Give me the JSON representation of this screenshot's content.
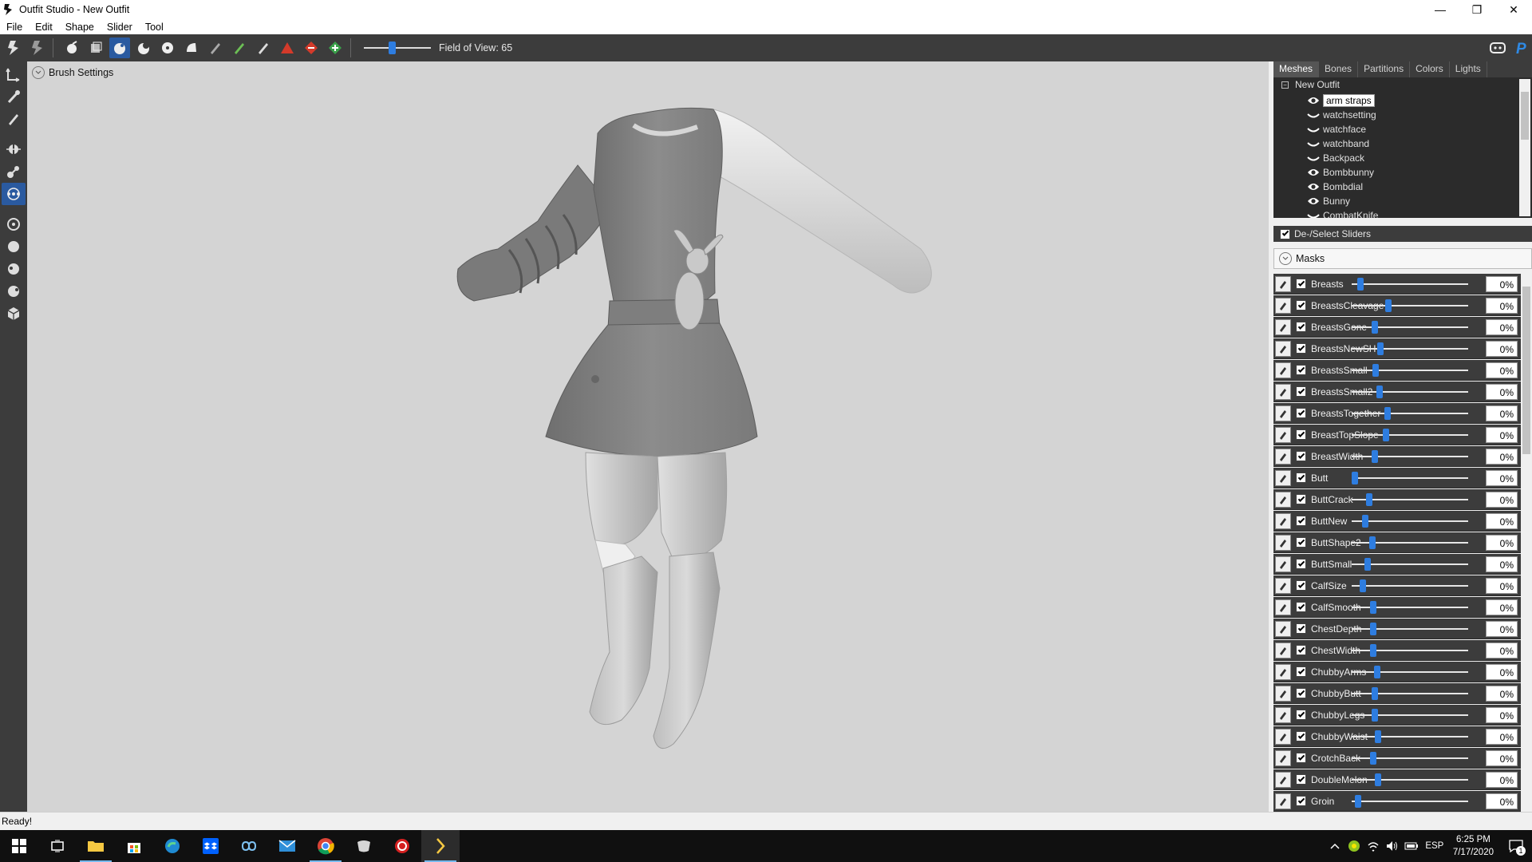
{
  "window": {
    "title": "Outfit Studio - New Outfit"
  },
  "menu": [
    "File",
    "Edit",
    "Shape",
    "Slider",
    "Tool"
  ],
  "toolbar": {
    "fov_label": "Field of View: 65",
    "fov_value": 65
  },
  "viewport": {
    "brush_settings_label": "Brush Settings"
  },
  "panel": {
    "tabs": [
      "Meshes",
      "Bones",
      "Partitions",
      "Colors",
      "Lights"
    ],
    "active_tab": "Meshes",
    "tree_root": "New Outfit",
    "meshes": [
      {
        "name": "arm straps",
        "visible": true,
        "selected": true
      },
      {
        "name": "watchsetting",
        "visible": false
      },
      {
        "name": "watchface",
        "visible": false
      },
      {
        "name": "watchband",
        "visible": false
      },
      {
        "name": "Backpack",
        "visible": false
      },
      {
        "name": "Bombbunny",
        "visible": true
      },
      {
        "name": "Bombdial",
        "visible": true
      },
      {
        "name": "Bunny",
        "visible": true
      },
      {
        "name": "CombatKnife",
        "visible": false
      }
    ],
    "deselect_label": "De-/Select Sliders",
    "masks_label": "Masks",
    "sliders": [
      {
        "name": "Breasts",
        "value": "0%",
        "pos": 0.05
      },
      {
        "name": "BreastsCleavage",
        "value": "0%",
        "pos": 0.29
      },
      {
        "name": "BreastsGone",
        "value": "0%",
        "pos": 0.17
      },
      {
        "name": "BreastsNewSH",
        "value": "0%",
        "pos": 0.22
      },
      {
        "name": "BreastsSmall",
        "value": "0%",
        "pos": 0.18
      },
      {
        "name": "BreastsSmall2",
        "value": "0%",
        "pos": 0.21
      },
      {
        "name": "BreastsTogether",
        "value": "0%",
        "pos": 0.28
      },
      {
        "name": "BreastTopSlope",
        "value": "0%",
        "pos": 0.27
      },
      {
        "name": "BreastWidth",
        "value": "0%",
        "pos": 0.17
      },
      {
        "name": "Butt",
        "value": "0%",
        "pos": 0.0
      },
      {
        "name": "ButtCrack",
        "value": "0%",
        "pos": 0.12
      },
      {
        "name": "ButtNew",
        "value": "0%",
        "pos": 0.09
      },
      {
        "name": "ButtShape2",
        "value": "0%",
        "pos": 0.15
      },
      {
        "name": "ButtSmall",
        "value": "0%",
        "pos": 0.11
      },
      {
        "name": "CalfSize",
        "value": "0%",
        "pos": 0.07
      },
      {
        "name": "CalfSmooth",
        "value": "0%",
        "pos": 0.16
      },
      {
        "name": "ChestDepth",
        "value": "0%",
        "pos": 0.16
      },
      {
        "name": "ChestWidth",
        "value": "0%",
        "pos": 0.16
      },
      {
        "name": "ChubbyArms",
        "value": "0%",
        "pos": 0.19
      },
      {
        "name": "ChubbyButt",
        "value": "0%",
        "pos": 0.17
      },
      {
        "name": "ChubbyLegs",
        "value": "0%",
        "pos": 0.17
      },
      {
        "name": "ChubbyWaist",
        "value": "0%",
        "pos": 0.2
      },
      {
        "name": "CrotchBack",
        "value": "0%",
        "pos": 0.16
      },
      {
        "name": "DoubleMelon",
        "value": "0%",
        "pos": 0.2
      },
      {
        "name": "Groin",
        "value": "0%",
        "pos": 0.03
      }
    ]
  },
  "status": {
    "text": "Ready!"
  },
  "taskbar": {
    "time": "6:25 PM",
    "date": "7/17/2020",
    "lang": "ESP",
    "notification_count": "1"
  },
  "colors": {
    "accent": "#2e7de0",
    "panel_dark": "#3c3c3c",
    "viewport_bg": "#d4d4d4",
    "active_button": "#2a5aa0"
  }
}
